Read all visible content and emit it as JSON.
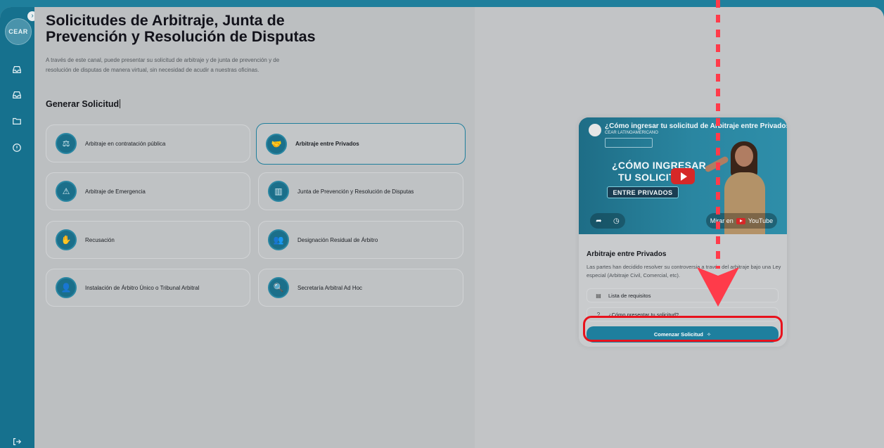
{
  "sidebar": {
    "logo_text": "CEAR",
    "expand_glyph": "›",
    "icons": [
      "inbox-icon",
      "inbox-icon",
      "folder-icon",
      "info-icon"
    ],
    "logout_icon": "logout-icon"
  },
  "page": {
    "title": "Solicitudes de Arbitraje, Junta de Prevención y Resolución de Disputas",
    "description": "A través de este canal, puede presentar su solicitud de arbitraje y de junta de prevención y de resolución de disputas de manera virtual, sin necesidad de acudir a nuestras oficinas.",
    "section_title": "Generar Solicitud"
  },
  "options": [
    {
      "label": "Arbitraje en contratación pública",
      "icon": "scales-icon",
      "selected": false
    },
    {
      "label": "Arbitraje entre Privados",
      "icon": "handshake-icon",
      "selected": true
    },
    {
      "label": "Arbitraje de Emergencia",
      "icon": "alert-icon",
      "selected": false
    },
    {
      "label": "Junta de Prevención y Resolución de Disputas",
      "icon": "building-icon",
      "selected": false
    },
    {
      "label": "Recusación",
      "icon": "hand-icon",
      "selected": false
    },
    {
      "label": "Designación Residual de Árbitro",
      "icon": "people-icon",
      "selected": false
    },
    {
      "label": "Instalación de Árbitro Único o Tribunal Arbitral",
      "icon": "person-icon",
      "selected": false
    },
    {
      "label": "Secretaría Arbitral Ad Hoc",
      "icon": "magnifier-icon",
      "selected": false
    }
  ],
  "video": {
    "title": "¿Cómo ingresar tu solicitud de Arbitraje entre Privados",
    "channel": "CEAR LATINOAMERICANO",
    "thumb_line1": "¿CÓMO INGRESAR",
    "thumb_line2": "TU SOLICITUD",
    "thumb_banner": "ENTRE PRIVADOS",
    "watch_on": "Mirar en",
    "youtube_label": "YouTube"
  },
  "card": {
    "title": "Arbitraje entre Privados",
    "description": "Las partes han decidido resolver su controversia a través del arbitraje bajo una Ley especial (Arbitraje Civil, Comercial, etc).",
    "link1": "Lista de requisitos",
    "link2": "¿Cómo presentar tu solicitud?",
    "start_button": "Comenzar Solicitud",
    "start_icon": "sparkle-icon"
  },
  "colors": {
    "primary": "#1e7f9e",
    "annotation": "#ff3b4a"
  }
}
